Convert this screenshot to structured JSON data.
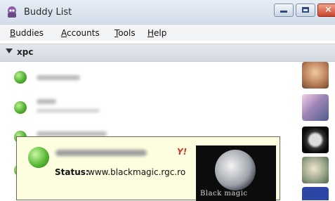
{
  "window": {
    "title": "Buddy List",
    "icon": "pidgin-app-icon",
    "controls": [
      "minimize-icon",
      "maximize-icon",
      "close-icon"
    ]
  },
  "menu": [
    "Buddies",
    "Accounts",
    "Tools",
    "Help"
  ],
  "group": {
    "name": "xpc",
    "expanded": true
  },
  "tooltip": {
    "protocol_mark": "Y!",
    "status_label": "Status:",
    "status_value": "www.blackmagic.rgc.ro",
    "photo_caption": "Black magic"
  },
  "colors": {
    "online": "#4caa2d",
    "tooltip_bg": "#fdfde0",
    "yahoo_red": "#d23a27"
  }
}
